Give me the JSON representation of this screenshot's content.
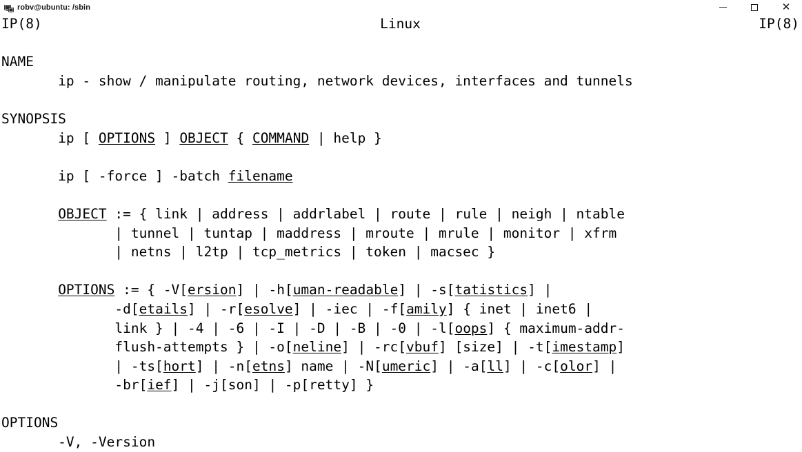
{
  "window": {
    "title": "robv@ubuntu: /sbin",
    "icon": "terminal-icon",
    "controls": {
      "minimize": "minimize-icon",
      "maximize": "maximize-icon",
      "close": "close-icon"
    }
  },
  "manpage": {
    "header": {
      "left": "IP(8)",
      "center": "Linux",
      "right": "IP(8)"
    },
    "lines": [
      {
        "id": "blank-1",
        "segs": []
      },
      {
        "id": "section-name",
        "segs": [
          {
            "t": "NAME",
            "u": false
          }
        ]
      },
      {
        "id": "name-desc",
        "segs": [
          {
            "t": "       ip - show / manipulate routing, network devices, interfaces and tunnels",
            "u": false
          }
        ]
      },
      {
        "id": "blank-2",
        "segs": []
      },
      {
        "id": "section-synopsis",
        "segs": [
          {
            "t": "SYNOPSIS",
            "u": false
          }
        ]
      },
      {
        "id": "syn-main",
        "segs": [
          {
            "t": "       ip [ ",
            "u": false
          },
          {
            "t": "OPTIONS",
            "u": true
          },
          {
            "t": " ] ",
            "u": false
          },
          {
            "t": "OBJECT",
            "u": true
          },
          {
            "t": " { ",
            "u": false
          },
          {
            "t": "COMMAND",
            "u": true
          },
          {
            "t": " | help }",
            "u": false
          }
        ]
      },
      {
        "id": "blank-3",
        "segs": []
      },
      {
        "id": "syn-batch",
        "segs": [
          {
            "t": "       ip [ -force ] -batch ",
            "u": false
          },
          {
            "t": "filename",
            "u": true
          }
        ]
      },
      {
        "id": "blank-4",
        "segs": []
      },
      {
        "id": "obj-1",
        "segs": [
          {
            "t": "       ",
            "u": false
          },
          {
            "t": "OBJECT",
            "u": true
          },
          {
            "t": " := { link | address | addrlabel | route | rule | neigh | ntable",
            "u": false
          }
        ]
      },
      {
        "id": "obj-2",
        "segs": [
          {
            "t": "              | tunnel | tuntap | maddress | mroute | mrule | monitor | xfrm",
            "u": false
          }
        ]
      },
      {
        "id": "obj-3",
        "segs": [
          {
            "t": "              | netns | l2tp | tcp_metrics | token | macsec }",
            "u": false
          }
        ]
      },
      {
        "id": "blank-5",
        "segs": []
      },
      {
        "id": "opt-1",
        "segs": [
          {
            "t": "       ",
            "u": false
          },
          {
            "t": "OPTIONS",
            "u": true
          },
          {
            "t": " := { -V[",
            "u": false
          },
          {
            "t": "ersion",
            "u": true
          },
          {
            "t": "] | -h[",
            "u": false
          },
          {
            "t": "uman-readable",
            "u": true
          },
          {
            "t": "] | -s[",
            "u": false
          },
          {
            "t": "tatistics",
            "u": true
          },
          {
            "t": "] |",
            "u": false
          }
        ]
      },
      {
        "id": "opt-2",
        "segs": [
          {
            "t": "              -d[",
            "u": false
          },
          {
            "t": "etails",
            "u": true
          },
          {
            "t": "] | -r[",
            "u": false
          },
          {
            "t": "esolve",
            "u": true
          },
          {
            "t": "] | -iec | -f[",
            "u": false
          },
          {
            "t": "amily",
            "u": true
          },
          {
            "t": "] { inet | inet6 |",
            "u": false
          }
        ]
      },
      {
        "id": "opt-3",
        "segs": [
          {
            "t": "              link } | -4 | -6 | -I | -D | -B | -0 | -l[",
            "u": false
          },
          {
            "t": "oops",
            "u": true
          },
          {
            "t": "] { maximum-addr-",
            "u": false
          }
        ]
      },
      {
        "id": "opt-4",
        "segs": [
          {
            "t": "              flush-attempts } | -o[",
            "u": false
          },
          {
            "t": "neline",
            "u": true
          },
          {
            "t": "] | -rc[",
            "u": false
          },
          {
            "t": "vbuf",
            "u": true
          },
          {
            "t": "] [size] | -t[",
            "u": false
          },
          {
            "t": "imestamp",
            "u": true
          },
          {
            "t": "]",
            "u": false
          }
        ]
      },
      {
        "id": "opt-5",
        "segs": [
          {
            "t": "              | -ts[",
            "u": false
          },
          {
            "t": "hort",
            "u": true
          },
          {
            "t": "] | -n[",
            "u": false
          },
          {
            "t": "etns",
            "u": true
          },
          {
            "t": "] name | -N[",
            "u": false
          },
          {
            "t": "umeric",
            "u": true
          },
          {
            "t": "] | -a[",
            "u": false
          },
          {
            "t": "ll",
            "u": true
          },
          {
            "t": "] | -c[",
            "u": false
          },
          {
            "t": "olor",
            "u": true
          },
          {
            "t": "] |",
            "u": false
          }
        ]
      },
      {
        "id": "opt-6",
        "segs": [
          {
            "t": "              -br[",
            "u": false
          },
          {
            "t": "ief",
            "u": true
          },
          {
            "t": "] | -j[son] | -p[retty] }",
            "u": false
          }
        ]
      },
      {
        "id": "blank-6",
        "segs": []
      },
      {
        "id": "section-options",
        "segs": [
          {
            "t": "OPTIONS",
            "u": false
          }
        ]
      },
      {
        "id": "opt-version",
        "segs": [
          {
            "t": "       -V, -Version",
            "u": false
          }
        ]
      }
    ]
  }
}
